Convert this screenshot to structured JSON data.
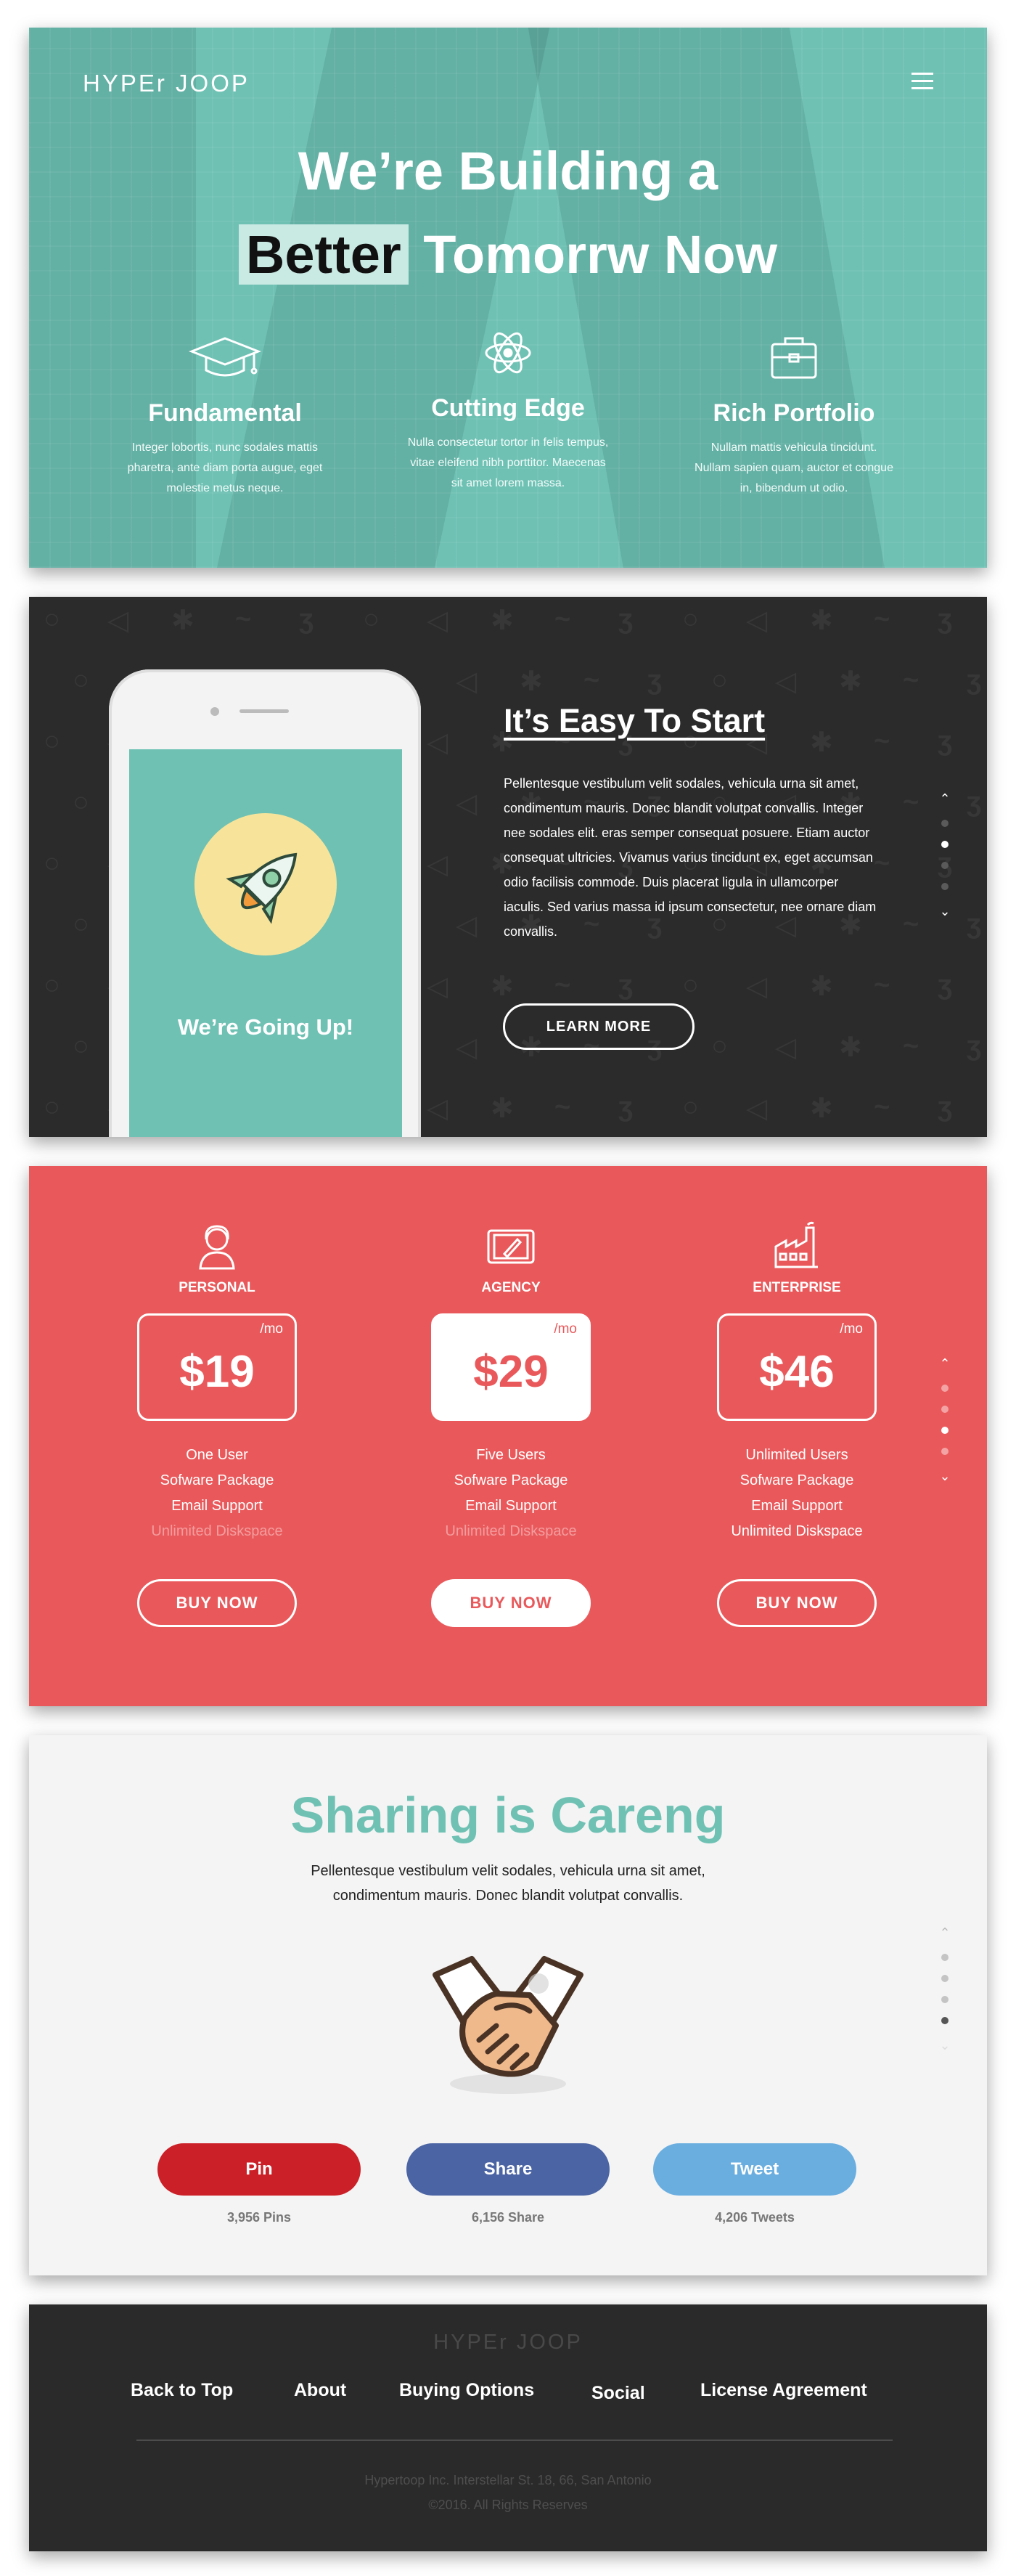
{
  "colors": {
    "teal": "#6fc1b4",
    "dark": "#2b2b2b",
    "coral": "#e9595b",
    "light": "#f4f4f4",
    "pinterest": "#cb2027",
    "facebook": "#4b64a3",
    "twitter": "#6aaee0"
  },
  "hero": {
    "logo": "HYPEr JOOP",
    "menu_icon": "hamburger-icon",
    "title_line1": "We’re Building a",
    "title_highlight": "Better",
    "title_rest": "Tomorrw Now",
    "features": [
      {
        "icon": "graduation-cap-icon",
        "title": "Fundamental",
        "text": "Integer lobortis, nunc sodales mattis pharetra, ante diam porta augue, eget molestie metus neque."
      },
      {
        "icon": "atom-icon",
        "title": "Cutting Edge",
        "text": "Nulla consectetur tortor in felis tempus, vitae eleifend nibh porttitor. Maecenas sit amet lorem massa."
      },
      {
        "icon": "briefcase-icon",
        "title": "Rich Portfolio",
        "text": "Nullam mattis vehicula tincidunt. Nullam sapien quam, auctor et congue in, bibendum ut odio."
      }
    ]
  },
  "start": {
    "phone_screen_text": "We’re Going Up!",
    "phone_icon": "rocket-icon",
    "title": "It’s Easy To Start",
    "text": "Pellentesque vestibulum velit sodales, vehicula urna sit amet, condimentum mauris. Donec blandit volutpat convallis. Integer nee sodales elit. eras semper consequat posuere. Etiam auctor consequat ultricies. Vivamus varius tincidunt ex, eget accumsan odio facilisis commode. Duis placerat ligula in ullamcorper iaculis. Sed varius massa id ipsum consectetur, nee ornare diam convallis.",
    "button": "LEARN MORE",
    "active_dot": 2
  },
  "pricing": {
    "plans": [
      {
        "icon": "person-icon",
        "name": "PERSONAL",
        "price": "$19",
        "per": "/mo",
        "features": [
          "One User",
          "Sofware Package",
          "Email Support"
        ],
        "disabled_feature": "Unlimited Diskspace",
        "button": "BUY NOW"
      },
      {
        "icon": "tablet-pen-icon",
        "name": "AGENCY",
        "price": "$29",
        "per": "/mo",
        "features": [
          "Five Users",
          "Sofware Package",
          "Email Support"
        ],
        "disabled_feature": "Unlimited Diskspace",
        "button": "BUY NOW"
      },
      {
        "icon": "factory-icon",
        "name": "ENTERPRISE",
        "price": "$46",
        "per": "/mo",
        "features": [
          "Unlimited Users",
          "Sofware Package",
          "Email Support",
          "Unlimited Diskspace"
        ],
        "button": "BUY NOW"
      }
    ],
    "active_dot": 3
  },
  "sharing": {
    "title": "Sharing is Careng",
    "text": "Pellentesque vestibulum velit sodales, vehicula urna sit amet, condimentum mauris. Donec blandit volutpat convallis.",
    "icon": "handshake-icon",
    "buttons": [
      {
        "label": "Pin",
        "count": "3,956 Pins"
      },
      {
        "label": "Share",
        "count": "6,156 Share"
      },
      {
        "label": "Tweet",
        "count": "4,206 Tweets"
      }
    ],
    "active_dot": 4
  },
  "footer": {
    "logo": "HYPEr JOOP",
    "links": [
      "Back to Top",
      "About",
      "Buying Options",
      "Social",
      "License Agreement"
    ],
    "address": "Hypertoop Inc. Interstellar St. 18, 66, San Antonio",
    "copyright": "©2016. All Rights Reserves"
  }
}
